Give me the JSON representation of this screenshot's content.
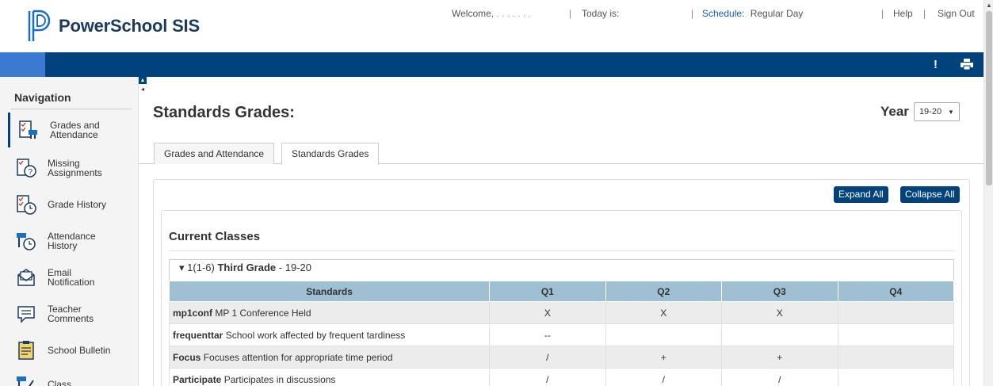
{
  "header": {
    "app_name": "PowerSchool SIS",
    "welcome_label": "Welcome,",
    "welcome_user": ". . . . . . .",
    "today_label": "Today is:",
    "schedule_label": "Schedule:",
    "schedule_value": "Regular Day",
    "help_label": "Help",
    "signout_label": "Sign Out",
    "separator": "|"
  },
  "toolbar": {
    "alert_glyph": "!"
  },
  "sidebar": {
    "title": "Navigation",
    "items": [
      {
        "label": "Grades and\nAttendance",
        "icon": "grades-attendance-icon",
        "active": true
      },
      {
        "label": "Missing\nAssignments",
        "icon": "missing-assignments-icon"
      },
      {
        "label": "Grade History",
        "icon": "grade-history-icon"
      },
      {
        "label": "Attendance\nHistory",
        "icon": "attendance-history-icon"
      },
      {
        "label": "Email\nNotification",
        "icon": "email-notification-icon"
      },
      {
        "label": "Teacher\nComments",
        "icon": "teacher-comments-icon"
      },
      {
        "label": "School Bulletin",
        "icon": "school-bulletin-icon"
      },
      {
        "label": "Class",
        "icon": "class-icon"
      }
    ]
  },
  "main": {
    "title": "Standards Grades:",
    "year_label": "Year",
    "year_value": "19-20",
    "tabs": [
      {
        "label": "Grades and Attendance",
        "active": false
      },
      {
        "label": "Standards Grades",
        "active": true
      }
    ],
    "expand_all": "Expand All",
    "collapse_all": "Collapse All",
    "section_title": "Current Classes",
    "class_header": {
      "arrow": "▾",
      "code": "1(1-6)",
      "name": "Third Grade",
      "term": "- 19-20"
    },
    "table": {
      "columns": [
        "Standards",
        "Q1",
        "Q2",
        "Q3",
        "Q4"
      ],
      "rows": [
        {
          "code": "mp1conf",
          "desc": "MP 1 Conference Held",
          "q1": "X",
          "q2": "X",
          "q3": "X",
          "q4": ""
        },
        {
          "code": "frequenttar",
          "desc": "School work affected by frequent tardiness",
          "q1": "--",
          "q2": "",
          "q3": "",
          "q4": ""
        },
        {
          "code": "Focus",
          "desc": "Focuses attention for appropriate time period",
          "q1": "/",
          "q2": "+",
          "q3": "+",
          "q4": ""
        },
        {
          "code": "Participate",
          "desc": "Participates in discussions",
          "q1": "/",
          "q2": "/",
          "q3": "/",
          "q4": ""
        }
      ]
    }
  },
  "colors": {
    "brand_navy": "#00427c",
    "accent_blue": "#3b7ad1",
    "table_header": "#9fbfd2",
    "link": "#1a5fa6"
  }
}
